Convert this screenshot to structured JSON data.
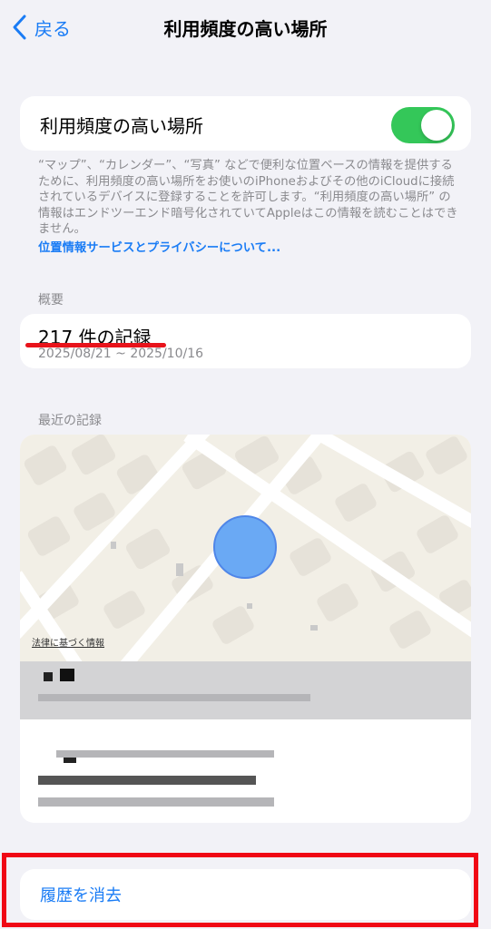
{
  "nav": {
    "back_label": "戻る",
    "title": "利用頻度の高い場所"
  },
  "toggle": {
    "label": "利用頻度の高い場所",
    "on": true
  },
  "footnote": {
    "text": "“マップ”、“カレンダー”、“写真” などで便利な位置ベースの情報を提供するために、利用頻度の高い場所をお使いのiPhoneおよびその他のiCloudに接続されているデバイスに登録することを許可します。“利用頻度の高い場所” の情報はエンドツーエンド暗号化されていてAppleはこの情報を読むことはできません。",
    "link": "位置情報サービスとプライバシーについて..."
  },
  "summary": {
    "header": "概要",
    "count": "217 件の記録",
    "date_range": "2025/08/21 ~ 2025/10/16"
  },
  "recent": {
    "header": "最近の記録",
    "map_legal": "法律に基づく情報"
  },
  "clear_history": {
    "label": "履歴を消去"
  },
  "colors": {
    "accent": "#1a7cf5",
    "toggle_on": "#34c759",
    "annotation_red": "#e8131b",
    "location_dot": "#6aa9f4"
  }
}
